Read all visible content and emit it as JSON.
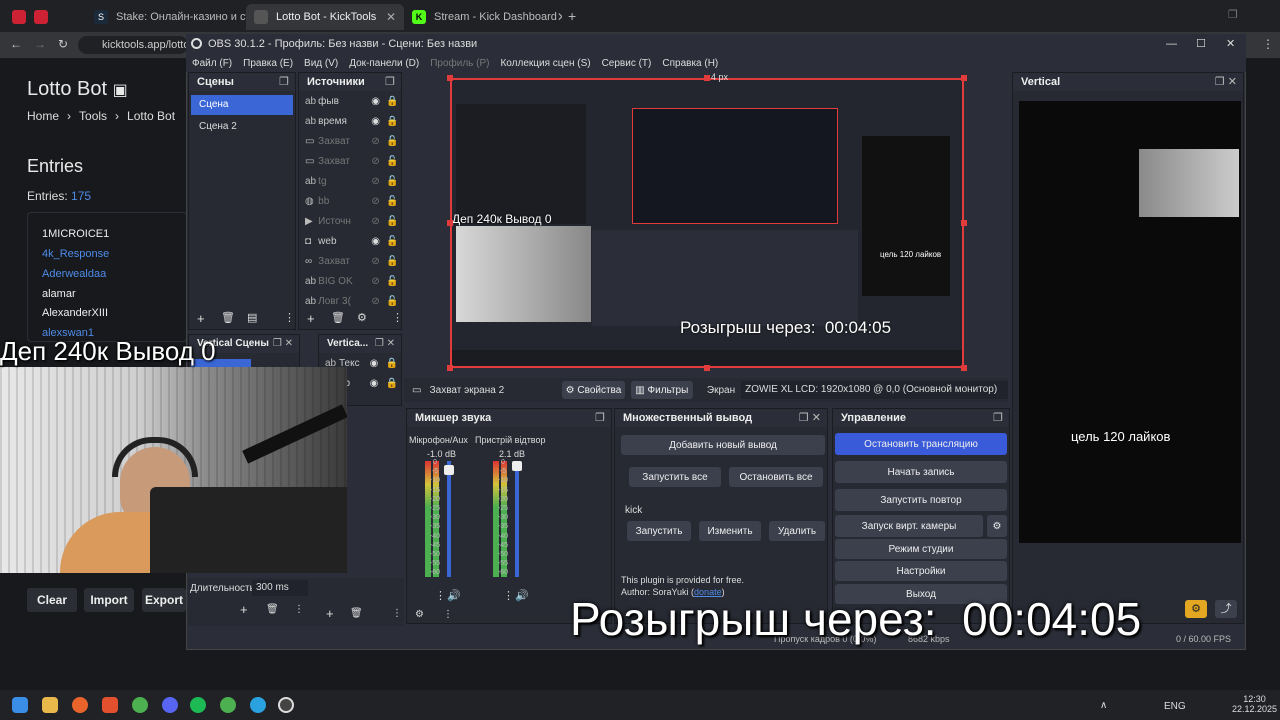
{
  "browser": {
    "tabs": [
      {
        "label": "Stake: Онлайн-казино и ст",
        "favicon_color": "#1b2a3a"
      },
      {
        "label": "Lotto Bot - KickTools",
        "favicon_color": "#444"
      },
      {
        "label": "Stream - Kick Dashboard",
        "favicon_color": "#53fc18"
      }
    ],
    "url": "kicktools.app/lottob"
  },
  "site": {
    "title": "Lotto Bot",
    "breadcrumb": [
      "Home",
      "Tools",
      "Lotto Bot"
    ],
    "entries_heading": "Entries",
    "entries_label": "Entries:",
    "entries_count": "175",
    "entries": [
      {
        "name": "1MICROICE1",
        "link": false
      },
      {
        "name": "4k_Response",
        "link": true
      },
      {
        "name": "Aderwealdaa",
        "link": true
      },
      {
        "name": "alamar",
        "link": false
      },
      {
        "name": "AlexanderXIII",
        "link": false
      },
      {
        "name": "alexswan1",
        "link": true
      }
    ],
    "buttons": {
      "clear": "Clear",
      "import": "Import",
      "export": "Export"
    }
  },
  "obs": {
    "title": "OBS 30.1.2 - Профиль: Без назви - Сцени: Без назви",
    "menu": [
      "Файл (F)",
      "Правка (E)",
      "Вид (V)",
      "Док-панели (D)",
      "Профиль (P)",
      "Коллекция сцен (S)",
      "Сервис (T)",
      "Справка (H)"
    ],
    "scenes": {
      "title": "Сцены",
      "items": [
        "Сцена",
        "Сцена 2"
      ]
    },
    "sources": {
      "title": "Источники",
      "items": [
        {
          "icon": "text",
          "name": "фыв",
          "hidden": false
        },
        {
          "icon": "text",
          "name": "время",
          "hidden": false
        },
        {
          "icon": "capture",
          "name": "Захват",
          "hidden": true
        },
        {
          "icon": "capture",
          "name": "Захват",
          "hidden": true
        },
        {
          "icon": "text",
          "name": "tg",
          "hidden": true
        },
        {
          "icon": "browser",
          "name": "bb",
          "hidden": true
        },
        {
          "icon": "media",
          "name": "Источн",
          "hidden": true
        },
        {
          "icon": "camera",
          "name": "web",
          "hidden": false
        },
        {
          "icon": "capture",
          "name": "Захват",
          "hidden": true
        },
        {
          "icon": "text",
          "name": "BIG OK",
          "hidden": true
        },
        {
          "icon": "text",
          "name": "Ловг 3(",
          "hidden": true
        }
      ]
    },
    "vertical_scenes_title": "Vertical Сцены",
    "vertical_sources_title": "Vertica...",
    "vertical_sources": [
      "Текс",
      "eb"
    ],
    "duration_label": "Длительность",
    "duration_value": "300 ms",
    "preview_top_label": "4 px",
    "preview_inner_overlay": "Розыгрыш через:",
    "preview_inner_timer": "00:04:05",
    "preview_inner_dep": "Деп 240к Вывод 0",
    "preview_inner_goal": "цель 120 лайков",
    "source_toolbar": {
      "name": "Захват экрана 2",
      "props": "Свойства",
      "filters": "Фильтры",
      "screen_label": "Экран",
      "screen_value": "ZOWIE XL LCD: 1920x1080 @ 0,0 (Основной монитор)"
    },
    "mixer": {
      "title": "Микшер звука",
      "channels": [
        {
          "name": "Мікрофон/Aux",
          "db": "-1.0 dB"
        },
        {
          "name": "Пристрій відтвор",
          "db": "2.1 dB"
        }
      ],
      "scale": [
        "0",
        "-5",
        "-10",
        "-15",
        "-20",
        "-25",
        "-30",
        "-35",
        "-40",
        "-45",
        "-50",
        "-55",
        "-60"
      ]
    },
    "multi_output": {
      "title": "Множественный вывод",
      "add": "Добавить новый вывод",
      "start_all": "Запустить все",
      "stop_all": "Остановить все",
      "target": "kick",
      "start": "Запустить",
      "edit": "Изменить",
      "delete": "Удалить",
      "note": "This plugin is provided for free.",
      "author_prefix": "Author: SoraYuki (",
      "donate": "donate",
      "author_suffix": ")"
    },
    "controls": {
      "title": "Управление",
      "stop_stream": "Остановить трансляцию",
      "start_record": "Начать запись",
      "start_replay": "Запустить повтор",
      "virtual_cam": "Запуск вирт. камеры",
      "studio": "Режим студии",
      "settings": "Настройки",
      "exit": "Выход"
    },
    "vertical": {
      "title": "Vertical",
      "goal": "цель 120 лайков"
    },
    "status": {
      "dropped": "Пропуск кадров 0 (0.0%)",
      "kbps": "8682 kbps",
      "fps": "0 / 60.00 FPS"
    }
  },
  "overlay": {
    "dep": "Деп 240к Вывод 0",
    "giveaway": "Розыгрыш через:",
    "timer": "00:04:05"
  },
  "taskbar": {
    "lang": "ENG",
    "time": "12:30",
    "date": "22.12.2025"
  }
}
